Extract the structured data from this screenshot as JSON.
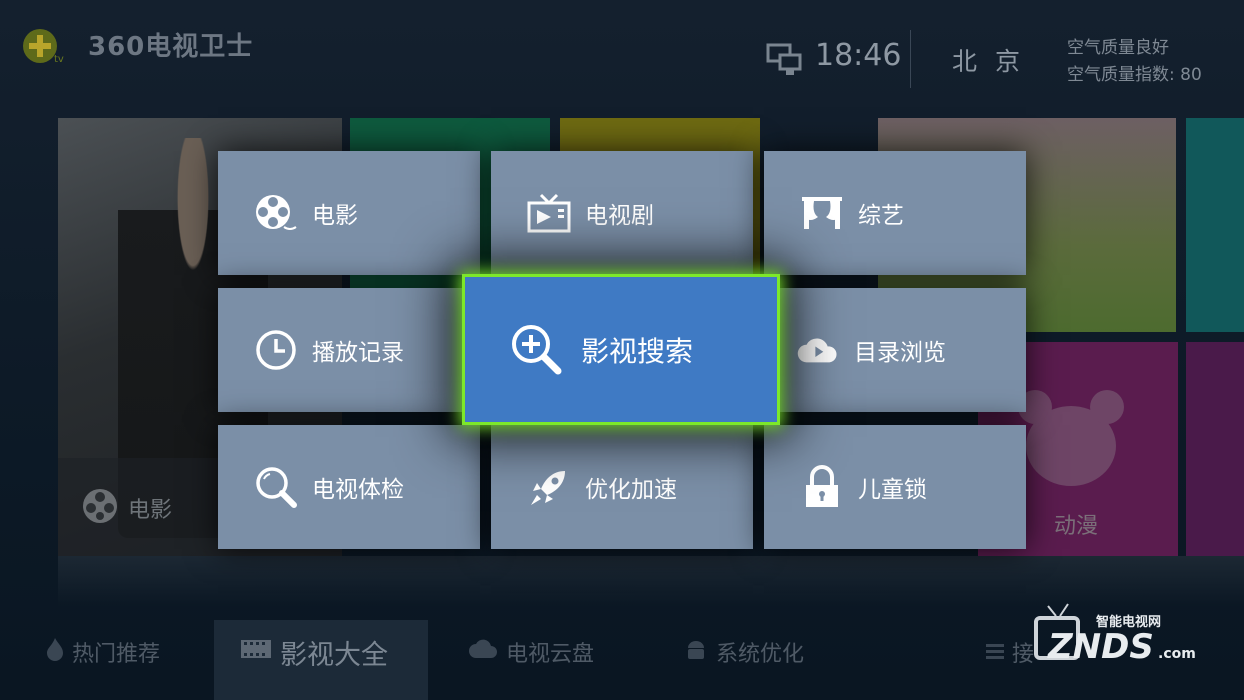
{
  "header": {
    "app_title": "360电视卫士",
    "time": "18:46",
    "city": "北京",
    "air_quality": "空气质量良好",
    "air_quality_index": "空气质量指数: 80"
  },
  "background": {
    "poster_label": "电影",
    "cartoon_label": "动漫"
  },
  "menu": {
    "items": [
      {
        "label": "电影",
        "icon": "film-reel-icon"
      },
      {
        "label": "电视剧",
        "icon": "tv-icon"
      },
      {
        "label": "综艺",
        "icon": "stage-curtain-icon"
      },
      {
        "label": "播放记录",
        "icon": "clock-icon"
      },
      {
        "label": "影视搜索",
        "icon": "zoom-in-icon",
        "focused": true
      },
      {
        "label": "目录浏览",
        "icon": "cloud-play-icon"
      },
      {
        "label": "电视体检",
        "icon": "magnifier-icon"
      },
      {
        "label": "优化加速",
        "icon": "rocket-icon"
      },
      {
        "label": "儿童锁",
        "icon": "lock-icon"
      }
    ]
  },
  "bottom_nav": {
    "items": [
      {
        "label": "热门推荐",
        "icon": "flame-icon"
      },
      {
        "label": "影视大全",
        "icon": "film-strip-icon",
        "active": true
      },
      {
        "label": "电视云盘",
        "icon": "cloud-icon"
      },
      {
        "label": "系统优化",
        "icon": "android-icon"
      },
      {
        "label": "接",
        "icon": "menu-icon"
      }
    ]
  },
  "watermark": {
    "top": "智能电视网",
    "brand": "ZNDS",
    "suffix": ".com"
  },
  "colors": {
    "tile": "#7b8fa7",
    "focus": "#3f7ac4",
    "focus_border": "#7de82a"
  }
}
